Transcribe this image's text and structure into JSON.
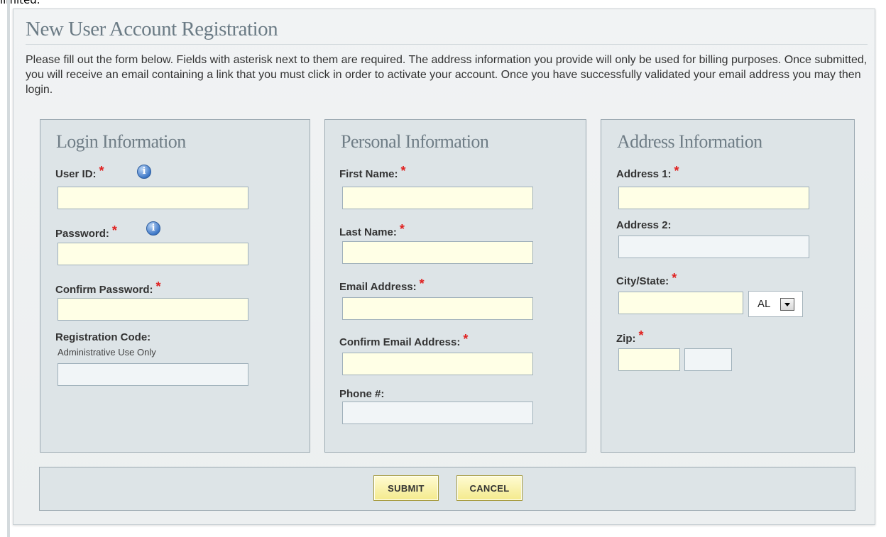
{
  "top_fragment": "limited.",
  "page_title": "New User Account Registration",
  "intro_text": "Please fill out the form below. Fields with asterisk next to them are required. The address information you provide will only be used for billing purposes. Once submitted, you will receive an email containing a link that you must click in order to activate your account. Once you have successfully validated your email address you may then login.",
  "required_mark": "*",
  "icons": {
    "info": "info-icon",
    "dropdown": "chevron-down-icon"
  },
  "colors": {
    "required": "#e0201f",
    "required_field_bg": "#ffffe6",
    "optional_field_bg": "#f1f5f7",
    "button_bg": "#f4ea8c"
  },
  "login": {
    "title": "Login Information",
    "user_id": {
      "label": "User ID:",
      "value": ""
    },
    "password": {
      "label": "Password:",
      "value": ""
    },
    "confirm_password": {
      "label": "Confirm Password:",
      "value": ""
    },
    "registration_code": {
      "label": "Registration Code:",
      "note": "Administrative Use Only",
      "value": ""
    }
  },
  "personal": {
    "title": "Personal Information",
    "first_name": {
      "label": "First Name:",
      "value": ""
    },
    "last_name": {
      "label": "Last Name:",
      "value": ""
    },
    "email": {
      "label": "Email Address:",
      "value": ""
    },
    "confirm_email": {
      "label": "Confirm Email Address:",
      "value": ""
    },
    "phone": {
      "label": "Phone #:",
      "value": ""
    }
  },
  "address": {
    "title": "Address Information",
    "address1": {
      "label": "Address 1:",
      "value": ""
    },
    "address2": {
      "label": "Address 2:",
      "value": ""
    },
    "city_state": {
      "label": "City/State:",
      "city_value": "",
      "state_selected": "AL"
    },
    "zip": {
      "label": "Zip:",
      "value": "",
      "ext_value": ""
    }
  },
  "buttons": {
    "submit": "SUBMIT",
    "cancel": "CANCEL"
  }
}
